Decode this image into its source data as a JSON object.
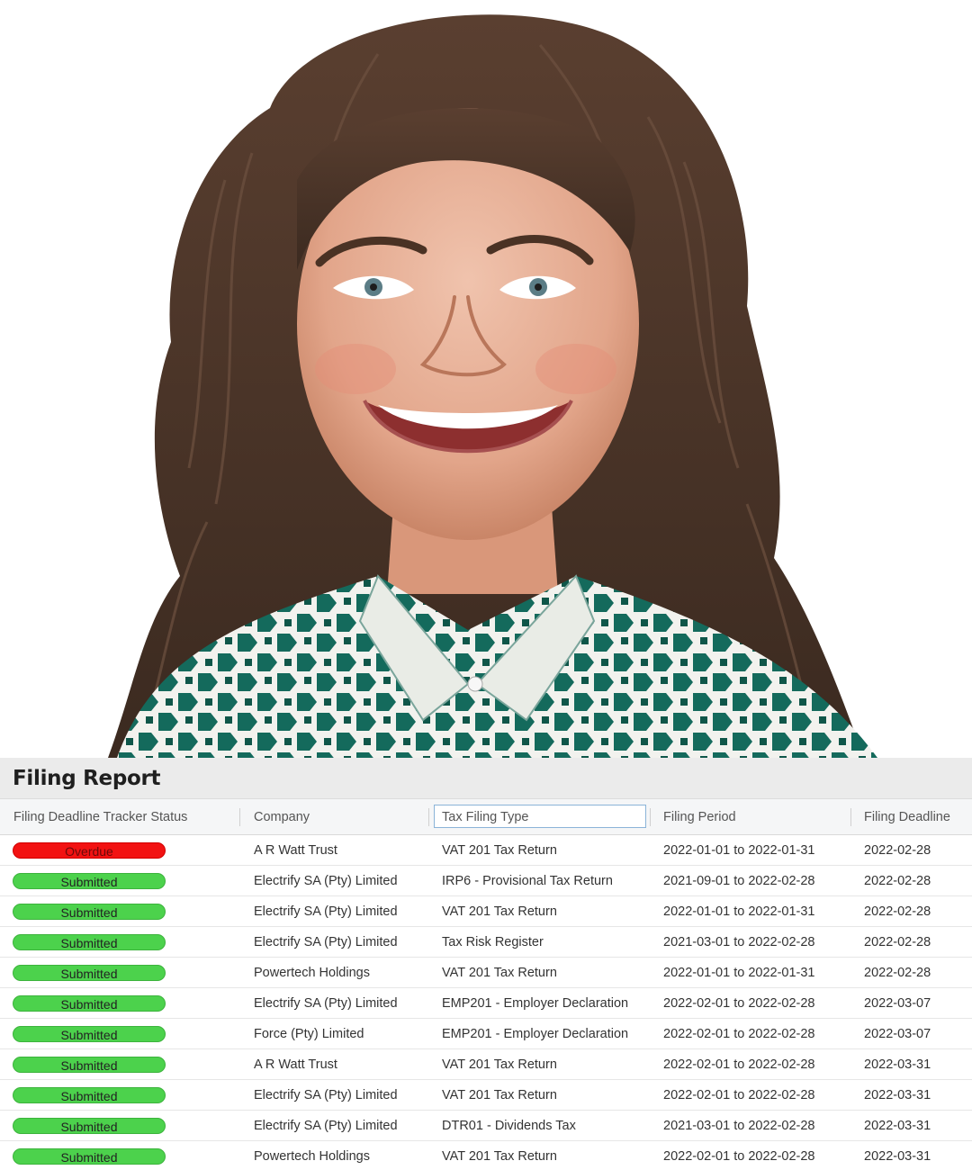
{
  "report": {
    "title": "Filing Report",
    "columns": {
      "status": "Filing Deadline Tracker Status",
      "company": "Company",
      "type": "Tax Filing Type",
      "period": "Filing Period",
      "deadline": "Filing Deadline"
    },
    "status_colors": {
      "Submitted": "#4cd24c",
      "Overdue": "#f21212"
    },
    "rows": [
      {
        "status": "Overdue",
        "company": "A R Watt Trust",
        "type": "VAT 201 Tax Return",
        "period": "2022-01-01 to 2022-01-31",
        "deadline": "2022-02-28"
      },
      {
        "status": "Submitted",
        "company": "Electrify SA (Pty) Limited",
        "type": "IRP6 - Provisional Tax Return",
        "period": "2021-09-01 to 2022-02-28",
        "deadline": "2022-02-28"
      },
      {
        "status": "Submitted",
        "company": "Electrify SA (Pty) Limited",
        "type": "VAT 201 Tax Return",
        "period": "2022-01-01 to 2022-01-31",
        "deadline": "2022-02-28"
      },
      {
        "status": "Submitted",
        "company": "Electrify SA (Pty) Limited",
        "type": "Tax Risk Register",
        "period": "2021-03-01 to 2022-02-28",
        "deadline": "2022-02-28"
      },
      {
        "status": "Submitted",
        "company": "Powertech Holdings",
        "type": "VAT 201 Tax Return",
        "period": "2022-01-01 to 2022-01-31",
        "deadline": "2022-02-28"
      },
      {
        "status": "Submitted",
        "company": "Electrify SA (Pty) Limited",
        "type": "EMP201 - Employer Declaration",
        "period": "2022-02-01 to 2022-02-28",
        "deadline": "2022-03-07"
      },
      {
        "status": "Submitted",
        "company": "Force (Pty) Limited",
        "type": "EMP201 - Employer Declaration",
        "period": "2022-02-01 to 2022-02-28",
        "deadline": "2022-03-07"
      },
      {
        "status": "Submitted",
        "company": "A R Watt Trust",
        "type": "VAT 201 Tax Return",
        "period": "2022-02-01 to 2022-02-28",
        "deadline": "2022-03-31"
      },
      {
        "status": "Submitted",
        "company": "Electrify SA (Pty) Limited",
        "type": "VAT 201 Tax Return",
        "period": "2022-02-01 to 2022-02-28",
        "deadline": "2022-03-31"
      },
      {
        "status": "Submitted",
        "company": "Electrify SA (Pty) Limited",
        "type": "DTR01 - Dividends Tax",
        "period": "2021-03-01 to 2022-02-28",
        "deadline": "2022-03-31"
      },
      {
        "status": "Submitted",
        "company": "Powertech Holdings",
        "type": "VAT 201 Tax Return",
        "period": "2022-02-01 to 2022-02-28",
        "deadline": "2022-03-31"
      }
    ]
  }
}
